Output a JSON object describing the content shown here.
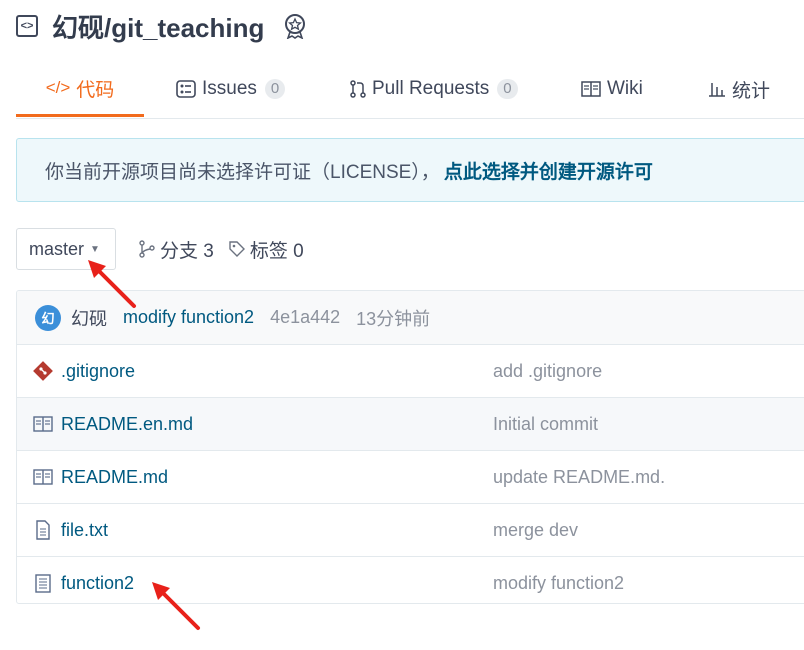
{
  "repo": {
    "title": "幻砚/git_teaching"
  },
  "tabs": [
    {
      "icon": "</>",
      "label": "代码",
      "active": true
    },
    {
      "label": "Issues",
      "count": "0"
    },
    {
      "label": "Pull Requests",
      "count": "0"
    },
    {
      "label": "Wiki"
    },
    {
      "label": "统计"
    }
  ],
  "notice": {
    "text": "你当前开源项目尚未选择许可证（LICENSE），",
    "link": "点此选择并创建开源许可"
  },
  "branch": {
    "current": "master",
    "branches_label": "分支 3",
    "tags_label": "标签 0"
  },
  "commit": {
    "avatar_text": "幻",
    "author": "幻砚",
    "message": "modify function2",
    "hash": "4e1a442",
    "time": "13分钟前"
  },
  "files": [
    {
      "name": ".gitignore",
      "commit": "add .gitignore",
      "icon": "git-icon"
    },
    {
      "name": "README.en.md",
      "commit": "Initial commit",
      "icon": "book-icon"
    },
    {
      "name": "README.md",
      "commit": "update README.md.",
      "icon": "book-icon"
    },
    {
      "name": "file.txt",
      "commit": "merge dev",
      "icon": "file-icon"
    },
    {
      "name": "function2",
      "commit": "modify function2",
      "icon": "file-lines-icon"
    }
  ],
  "colors": {
    "accent": "#f26b1d",
    "link": "#005980",
    "annotation_arrow": "#e8211a"
  }
}
